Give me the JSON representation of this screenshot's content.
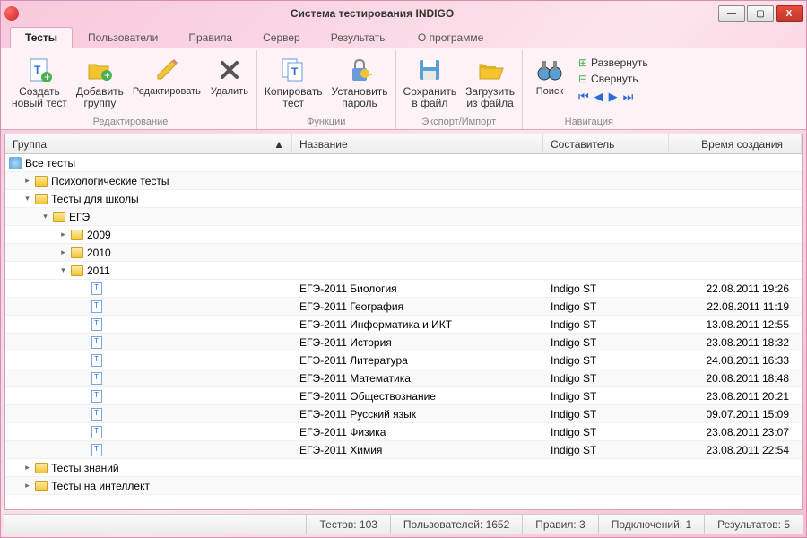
{
  "title": "Система тестирования INDIGO",
  "tabs": [
    "Тесты",
    "Пользователи",
    "Правила",
    "Сервер",
    "Результаты",
    "О программе"
  ],
  "ribbon": {
    "edit": {
      "label": "Редактирование",
      "create": "Создать\nновый тест",
      "addgroup": "Добавить\nгруппу",
      "editbtn": "Редактировать",
      "delete": "Удалить"
    },
    "func": {
      "label": "Функции",
      "copy": "Копировать\nтест",
      "password": "Установить\nпароль"
    },
    "io": {
      "label": "Экспорт/Импорт",
      "save": "Сохранить\nв файл",
      "load": "Загрузить\nиз файла"
    },
    "nav": {
      "label": "Навигация",
      "search": "Поиск",
      "expand": "Развернуть",
      "collapse": "Свернуть"
    }
  },
  "columns": {
    "group": "Группа",
    "name": "Название",
    "author": "Составитель",
    "time": "Время создания"
  },
  "tree": {
    "all": "Все тесты",
    "psych": "Психологические тесты",
    "school": "Тесты для школы",
    "ege": "ЕГЭ",
    "y2009": "2009",
    "y2010": "2010",
    "y2011": "2011",
    "knowledge": "Тесты знаний",
    "intellect": "Тесты на интеллект"
  },
  "tests": [
    {
      "name": "ЕГЭ-2011 Биология",
      "author": "Indigo ST",
      "time": "22.08.2011 19:26"
    },
    {
      "name": "ЕГЭ-2011 География",
      "author": "Indigo ST",
      "time": "22.08.2011 11:19"
    },
    {
      "name": "ЕГЭ-2011 Информатика и ИКТ",
      "author": "Indigo ST",
      "time": "13.08.2011 12:55"
    },
    {
      "name": "ЕГЭ-2011 История",
      "author": "Indigo ST",
      "time": "23.08.2011 18:32"
    },
    {
      "name": "ЕГЭ-2011 Литература",
      "author": "Indigo ST",
      "time": "24.08.2011 16:33"
    },
    {
      "name": "ЕГЭ-2011 Математика",
      "author": "Indigo ST",
      "time": "20.08.2011 18:48"
    },
    {
      "name": "ЕГЭ-2011 Обществознание",
      "author": "Indigo ST",
      "time": "23.08.2011 20:21"
    },
    {
      "name": "ЕГЭ-2011 Русский язык",
      "author": "Indigo ST",
      "time": "09.07.2011 15:09"
    },
    {
      "name": "ЕГЭ-2011 Физика",
      "author": "Indigo ST",
      "time": "23.08.2011 23:07"
    },
    {
      "name": "ЕГЭ-2011 Химия",
      "author": "Indigo ST",
      "time": "23.08.2011 22:54"
    }
  ],
  "status": {
    "tests": "Тестов: 103",
    "users": "Пользователей: 1652",
    "rules": "Правил: 3",
    "connections": "Подключений: 1",
    "results": "Результатов: 5"
  }
}
